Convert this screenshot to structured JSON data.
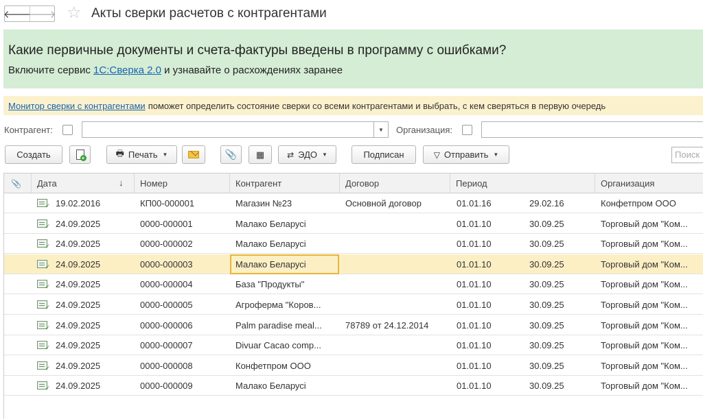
{
  "window": {
    "title": "Акты сверки расчетов с контрагентами",
    "back_icon": "arrow-left-icon",
    "forward_icon": "arrow-right-icon",
    "favorite_icon": "star-icon"
  },
  "promo": {
    "question": "Какие первичные документы и счета-фактуры введены в программу с ошибками?",
    "text_before": "Включите сервис",
    "link": "1С:Сверка 2.0",
    "text_after": "и узнавайте о расхождениях заранее"
  },
  "monitor": {
    "link": "Монитор сверки с контрагентами",
    "text": "поможет определить состояние сверки со всеми контрагентами и выбрать, с кем сверяться в первую очередь"
  },
  "filters": {
    "contractor_label": "Контрагент:",
    "contractor_value": "",
    "organization_label": "Организация:",
    "organization_value": ""
  },
  "toolbar": {
    "create_label": "Создать",
    "print_label": "Печать",
    "edo_label": "ЭДО",
    "signed_label": "Подписан",
    "send_label": "Отправить",
    "search_placeholder": "Поиск"
  },
  "table": {
    "columns": {
      "attach_icon": "paperclip-icon",
      "date": "Дата",
      "sort_icon": "↓",
      "number": "Номер",
      "contractor": "Контрагент",
      "contract": "Договор",
      "period": "Период",
      "organization": "Организация"
    },
    "rows": [
      {
        "date": "19.02.2016",
        "number": "КП00-000001",
        "contractor": "Магазин №23",
        "contract": "Основной договор",
        "period_from": "01.01.16",
        "period_to": "29.02.16",
        "organization": "Конфетпром ООО"
      },
      {
        "date": "24.09.2025",
        "number": "0000-000001",
        "contractor": "Малако Беларусі",
        "contract": "",
        "period_from": "01.01.10",
        "period_to": "30.09.25",
        "organization": "Торговый дом \"Ком..."
      },
      {
        "date": "24.09.2025",
        "number": "0000-000002",
        "contractor": "Малако Беларусі",
        "contract": "",
        "period_from": "01.01.10",
        "period_to": "30.09.25",
        "organization": "Торговый дом \"Ком..."
      },
      {
        "date": "24.09.2025",
        "number": "0000-000003",
        "contractor": "Малако Беларусі",
        "contract": "",
        "period_from": "01.01.10",
        "period_to": "30.09.25",
        "organization": "Торговый дом \"Ком..."
      },
      {
        "date": "24.09.2025",
        "number": "0000-000004",
        "contractor": "База \"Продукты\"",
        "contract": "",
        "period_from": "01.01.10",
        "period_to": "30.09.25",
        "organization": "Торговый дом \"Ком..."
      },
      {
        "date": "24.09.2025",
        "number": "0000-000005",
        "contractor": "Агроферма \"Коров...",
        "contract": "",
        "period_from": "01.01.10",
        "period_to": "30.09.25",
        "organization": "Торговый дом \"Ком..."
      },
      {
        "date": "24.09.2025",
        "number": "0000-000006",
        "contractor": "Palm paradise meal...",
        "contract": "78789 от 24.12.2014",
        "period_from": "01.01.10",
        "period_to": "30.09.25",
        "organization": "Торговый дом \"Ком..."
      },
      {
        "date": "24.09.2025",
        "number": "0000-000007",
        "contractor": "Divuar Cacao comp...",
        "contract": "",
        "period_from": "01.01.10",
        "period_to": "30.09.25",
        "organization": "Торговый дом \"Ком..."
      },
      {
        "date": "24.09.2025",
        "number": "0000-000008",
        "contractor": "Конфетпром ООО",
        "contract": "",
        "period_from": "01.01.10",
        "period_to": "30.09.25",
        "organization": "Торговый дом \"Ком..."
      },
      {
        "date": "24.09.2025",
        "number": "0000-000009",
        "contractor": "Малако Беларусі",
        "contract": "",
        "period_from": "01.01.10",
        "period_to": "30.09.25",
        "organization": "Торговый дом \"Ком..."
      }
    ]
  }
}
